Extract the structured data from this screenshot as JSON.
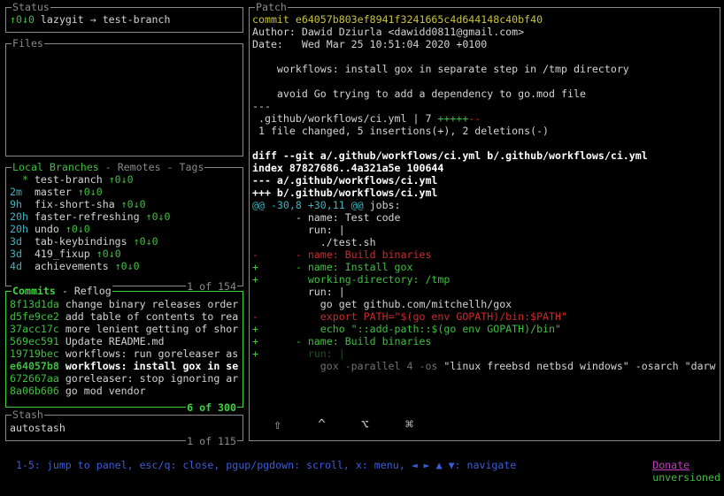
{
  "status": {
    "title": "Status",
    "ahead_behind": "↑0↓0",
    "text": " lazygit → test-branch"
  },
  "files": {
    "title": "Files"
  },
  "branches": {
    "tabs": [
      {
        "label": "Local Branches",
        "active": true
      },
      {
        "label": "Remotes",
        "active": false
      },
      {
        "label": "Tags",
        "active": false
      }
    ],
    "footer": "1 of 154",
    "items": [
      {
        "age": "  *",
        "name": "test-branch",
        "track": "↑0↓0"
      },
      {
        "age": "2m ",
        "name": "master",
        "track": "↑0↓0"
      },
      {
        "age": "9h ",
        "name": "fix-short-sha",
        "track": "↑0↓0"
      },
      {
        "age": "20h",
        "name": "faster-refreshing",
        "track": "↑0↓0"
      },
      {
        "age": "20h",
        "name": "undo",
        "track": "↑0↓0"
      },
      {
        "age": "3d ",
        "name": "tab-keybindings",
        "track": "↑0↓0"
      },
      {
        "age": "3d ",
        "name": "419_fixup",
        "track": "↑0↓0"
      },
      {
        "age": "4d ",
        "name": "achievements",
        "track": "↑0↓0"
      }
    ]
  },
  "commits": {
    "tabs": [
      {
        "label": "Commits",
        "active": true
      },
      {
        "label": "Reflog",
        "active": false
      }
    ],
    "footer": "6 of 300",
    "selected_index": 5,
    "items": [
      {
        "sha": "8f13d1da",
        "msg": "change binary releases order"
      },
      {
        "sha": "d5fe9ce2",
        "msg": "add table of contents to rea"
      },
      {
        "sha": "37acc17c",
        "msg": "more lenient getting of shor"
      },
      {
        "sha": "569ec591",
        "msg": "Update README.md"
      },
      {
        "sha": "19719bec",
        "msg": "workflows: run goreleaser as"
      },
      {
        "sha": "e64057b8",
        "msg": "workflows: install gox in se"
      },
      {
        "sha": "672667aa",
        "msg": "goreleaser: stop ignoring ar"
      },
      {
        "sha": "8a06b606",
        "msg": "go mod vendor"
      }
    ]
  },
  "stash": {
    "title": "Stash",
    "footer": "1 of 115",
    "items": [
      "autostash"
    ]
  },
  "patch": {
    "title": "Patch",
    "lines": [
      [
        [
          "y",
          "commit e64057b803ef8941f3241665c4d644148c40bf40"
        ]
      ],
      [
        [
          "w",
          "Author: Dawid Dziurla <dawidd0811@gmail.com>"
        ]
      ],
      [
        [
          "w",
          "Date:   Wed Mar 25 10:51:04 2020 +0100"
        ]
      ],
      [],
      [
        [
          "w",
          "    workflows: install gox in separate step in /tmp directory"
        ]
      ],
      [],
      [
        [
          "w",
          "    avoid Go trying to add a dependency to go.mod file"
        ]
      ],
      [
        [
          "w",
          "---"
        ]
      ],
      [
        [
          "w",
          " .github/workflows/ci.yml | 7 "
        ],
        [
          "g",
          "+++++"
        ],
        [
          "r",
          "--"
        ]
      ],
      [
        [
          "w",
          " 1 file changed, 5 insertions(+), 2 deletions(-)"
        ]
      ],
      [],
      [
        [
          "b",
          "diff --git a/.github/workflows/ci.yml b/.github/workflows/ci.yml"
        ]
      ],
      [
        [
          "b",
          "index 87827686..4a321a5e 100644"
        ]
      ],
      [
        [
          "b",
          "--- a/.github/workflows/ci.yml"
        ]
      ],
      [
        [
          "b",
          "+++ b/.github/workflows/ci.yml"
        ]
      ],
      [
        [
          "c",
          "@@ -30,8 +30,11 @@"
        ],
        [
          "w",
          " jobs:"
        ]
      ],
      [
        [
          "w",
          "       - name: Test code"
        ]
      ],
      [
        [
          "w",
          "         run: |"
        ]
      ],
      [
        [
          "w",
          "           ./test.sh"
        ]
      ],
      [
        [
          "r",
          "-      - name: Build binaries"
        ]
      ],
      [
        [
          "g",
          "+      - name: Install gox"
        ]
      ],
      [
        [
          "g",
          "+        working-directory: /tmp"
        ]
      ],
      [
        [
          "w",
          "         run: |"
        ]
      ],
      [
        [
          "w",
          "           go get github.com/mitchellh/gox"
        ]
      ],
      [
        [
          "r",
          "-          export PATH=\"$(go env GOPATH)/bin:$PATH\""
        ]
      ],
      [
        [
          "g",
          "+          echo \"::add-path::$(go env GOPATH)/bin\""
        ]
      ],
      [
        [
          "g",
          "+      - name: Build binaries"
        ]
      ],
      [
        [
          "g",
          "+"
        ],
        [
          "dimg",
          "        run: |"
        ]
      ],
      [
        [
          "dimw",
          "           gox -parallel 4 -os"
        ],
        [
          "w",
          " \"linux freebsd netbsd windows\" -osarch \"darw"
        ]
      ]
    ],
    "keystrokes": [
      "⇧",
      "^",
      "⌥",
      "⌘"
    ]
  },
  "bottom_bar": {
    "help": "1-5: jump to panel, esc/q: close, pgup/pgdown: scroll, x: menu, ◄ ► ▲ ▼: navigate",
    "donate": "Donate",
    "version": "unversioned"
  }
}
